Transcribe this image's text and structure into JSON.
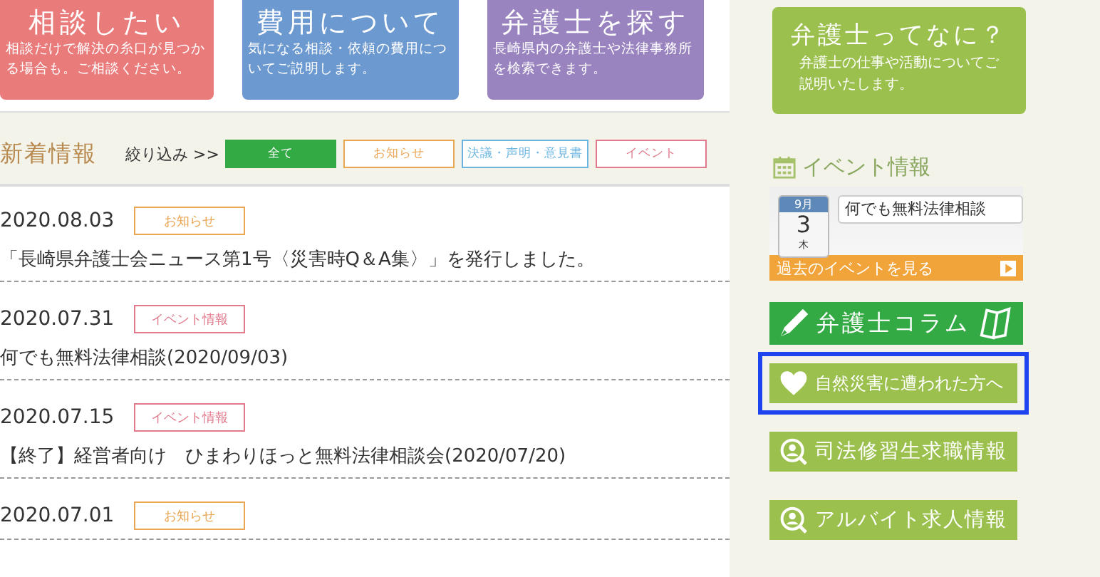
{
  "top_cards": [
    {
      "title": "相談したい",
      "text": "相談だけで解決の糸口が見つかる場合も。ご相談ください。",
      "color": "#e97b7b"
    },
    {
      "title": "費用について",
      "text": "気になる相談・依頼の費用についてご説明します。",
      "color": "#6c99cf"
    },
    {
      "title": "弁護士を探す",
      "text": "長崎県内の弁護士や法律事務所を検索できます。",
      "color": "#9a84c0"
    }
  ],
  "side_card": {
    "title": "弁護士ってなに？",
    "text": "弁護士の仕事や活動についてご説明いたします。"
  },
  "news": {
    "heading": "新着情報",
    "filter_label": "絞り込み >>",
    "filters": [
      {
        "label": "全て",
        "selected": true,
        "color": "#33aa44"
      },
      {
        "label": "お知らせ",
        "selected": false,
        "color": "#eaa653"
      },
      {
        "label": "決議・声明・意見書",
        "selected": false,
        "color": "#6bb5e0"
      },
      {
        "label": "イベント",
        "selected": false,
        "color": "#e07a8c"
      }
    ],
    "items": [
      {
        "date": "2020.08.03",
        "tag": "お知らせ",
        "color": "#eaa653",
        "title": "「長崎県弁護士会ニュース第1号〈災害時Q＆A集〉」を発行しました。"
      },
      {
        "date": "2020.07.31",
        "tag": "イベント情報",
        "color": "#e07a8c",
        "title": "何でも無料法律相談(2020/09/03)"
      },
      {
        "date": "2020.07.15",
        "tag": "イベント情報",
        "color": "#e07a8c",
        "title": "【終了】経営者向け　ひまわりほっと無料法律相談会(2020/07/20)"
      },
      {
        "date": "2020.07.01",
        "tag": "お知らせ",
        "color": "#eaa653"
      }
    ]
  },
  "events": {
    "heading": "イベント情報",
    "month": "9月",
    "day": "3",
    "weekday": "木",
    "event_title": "何でも無料法律相談",
    "past_link": "過去のイベントを見る"
  },
  "banners": [
    {
      "kind": "column",
      "label": "弁護士コラム"
    },
    {
      "kind": "heart",
      "label": "自然災害に遭われた方へ",
      "focused": true
    },
    {
      "kind": "search",
      "label": "司法修習生求職情報",
      "focused": false
    },
    {
      "kind": "search",
      "label": "アルバイト求人情報",
      "focused": false
    }
  ]
}
